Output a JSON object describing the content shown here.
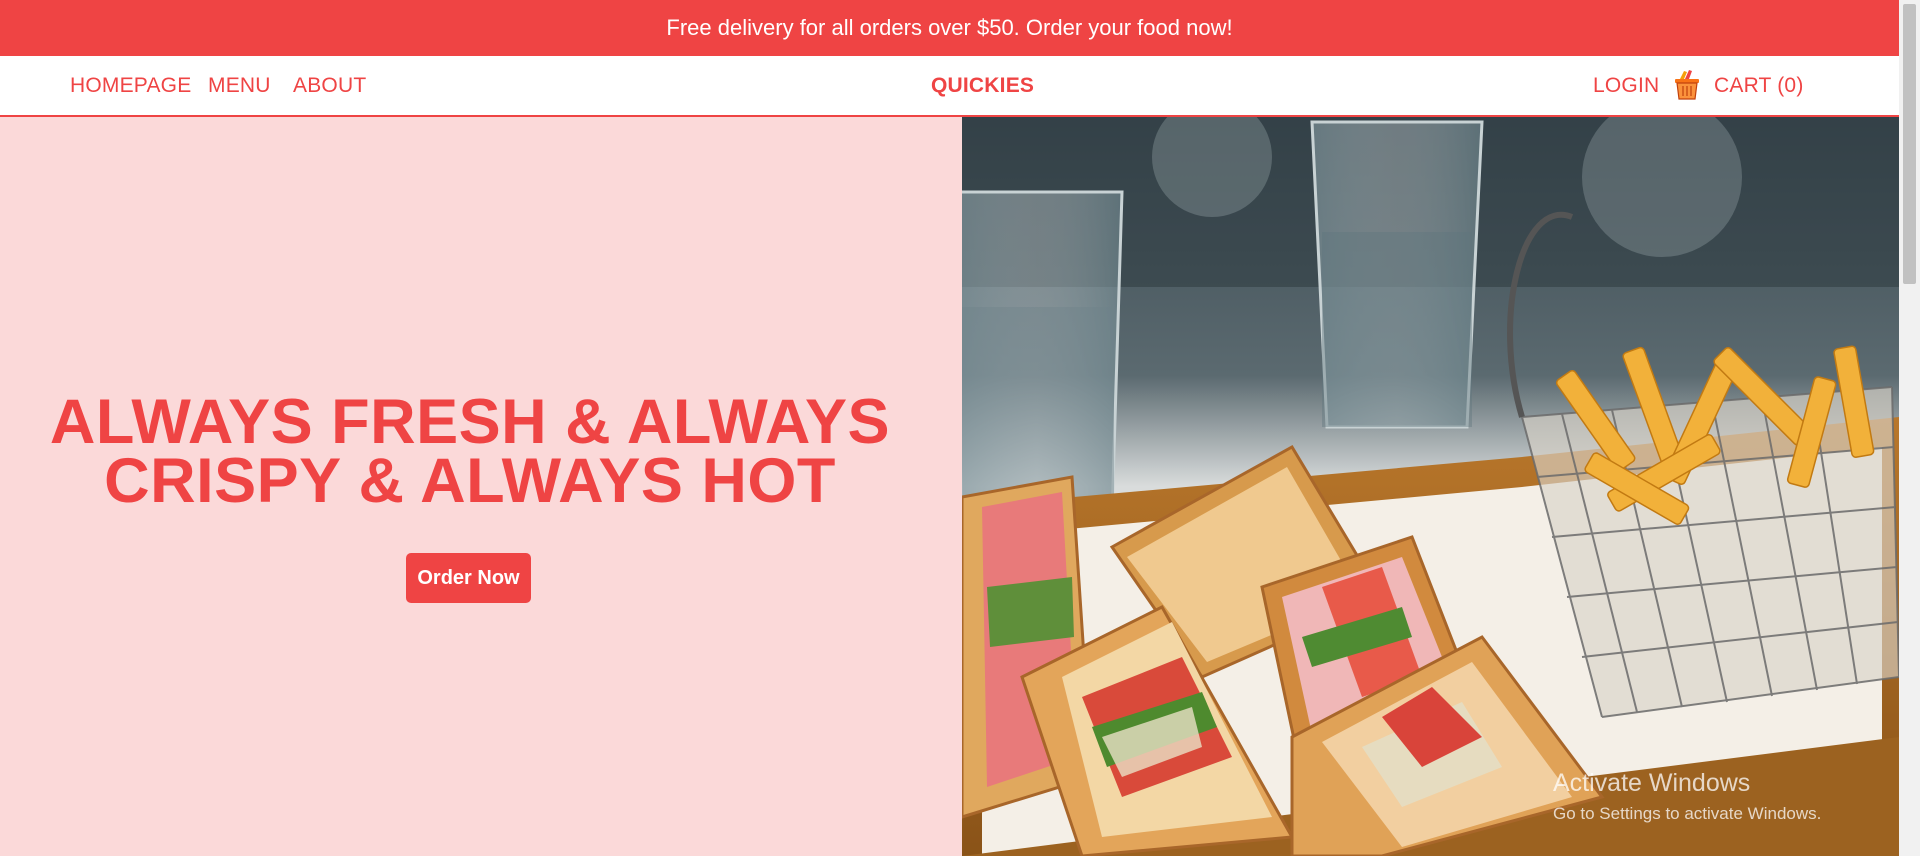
{
  "promo": {
    "text": "Free delivery for all orders over $50. Order your food now!"
  },
  "nav": {
    "links": [
      "HOMEPAGE",
      "MENU",
      "ABOUT"
    ],
    "brand": "QUICKIES",
    "login": "LOGIN",
    "cart_icon": "shopping-basket-icon",
    "cart": "CART (0)"
  },
  "hero": {
    "headline_line1": "ALWAYS FRESH & ALWAYS",
    "headline_line2": "CRISPY & ALWAYS HOT",
    "cta": "Order Now",
    "image_subject": "club sandwiches and fries on a wooden tray"
  },
  "watermark": {
    "title": "Activate Windows",
    "subtitle": "Go to Settings to activate Windows."
  },
  "colors": {
    "accent": "#ef4444",
    "hero_bg": "#fbd9d9",
    "white": "#ffffff"
  }
}
